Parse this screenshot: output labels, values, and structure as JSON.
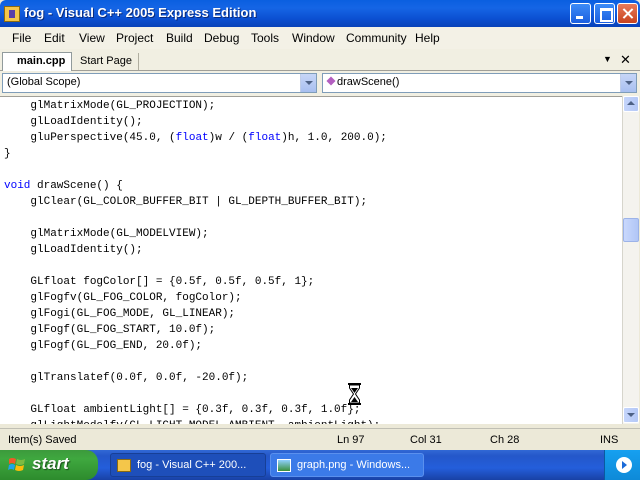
{
  "window": {
    "title": "fog - Visual C++ 2005 Express Edition"
  },
  "menu": [
    "File",
    "Edit",
    "View",
    "Project",
    "Build",
    "Debug",
    "Tools",
    "Window",
    "Community",
    "Help"
  ],
  "tabs": [
    {
      "label": "main.cpp",
      "active": true
    },
    {
      "label": "Start Page",
      "active": false
    }
  ],
  "scope": {
    "left": "(Global Scope)",
    "right": "drawScene()"
  },
  "code_lines": [
    "    glMatrixMode(GL_PROJECTION);",
    "    glLoadIdentity();",
    "    gluPerspective(45.0, (float)w / (float)h, 1.0, 200.0);",
    "}",
    "",
    "void drawScene() {",
    "    glClear(GL_COLOR_BUFFER_BIT | GL_DEPTH_BUFFER_BIT);",
    "",
    "    glMatrixMode(GL_MODELVIEW);",
    "    glLoadIdentity();",
    "",
    "    GLfloat fogColor[] = {0.5f, 0.5f, 0.5f, 1};",
    "    glFogfv(GL_FOG_COLOR, fogColor);",
    "    glFogi(GL_FOG_MODE, GL_LINEAR);",
    "    glFogf(GL_FOG_START, 10.0f);",
    "    glFogf(GL_FOG_END, 20.0f);",
    "",
    "    glTranslatef(0.0f, 0.0f, -20.0f);",
    "",
    "    GLfloat ambientLight[] = {0.3f, 0.3f, 0.3f, 1.0f};",
    "    glLightModelfv(GL_LIGHT_MODEL_AMBIENT, ambientLight);"
  ],
  "status": {
    "message": "Item(s) Saved",
    "line": "Ln 97",
    "col": "Col 31",
    "ch": "Ch 28",
    "mode": "INS"
  },
  "taskbar": {
    "start": "start",
    "tasks": [
      "fog - Visual C++ 200...",
      "graph.png - Windows..."
    ]
  },
  "colors": {
    "keyword": "#0000ff",
    "titlebar": "#0a5fe0",
    "taskbar": "#245edb",
    "start": "#3c9a3c"
  }
}
